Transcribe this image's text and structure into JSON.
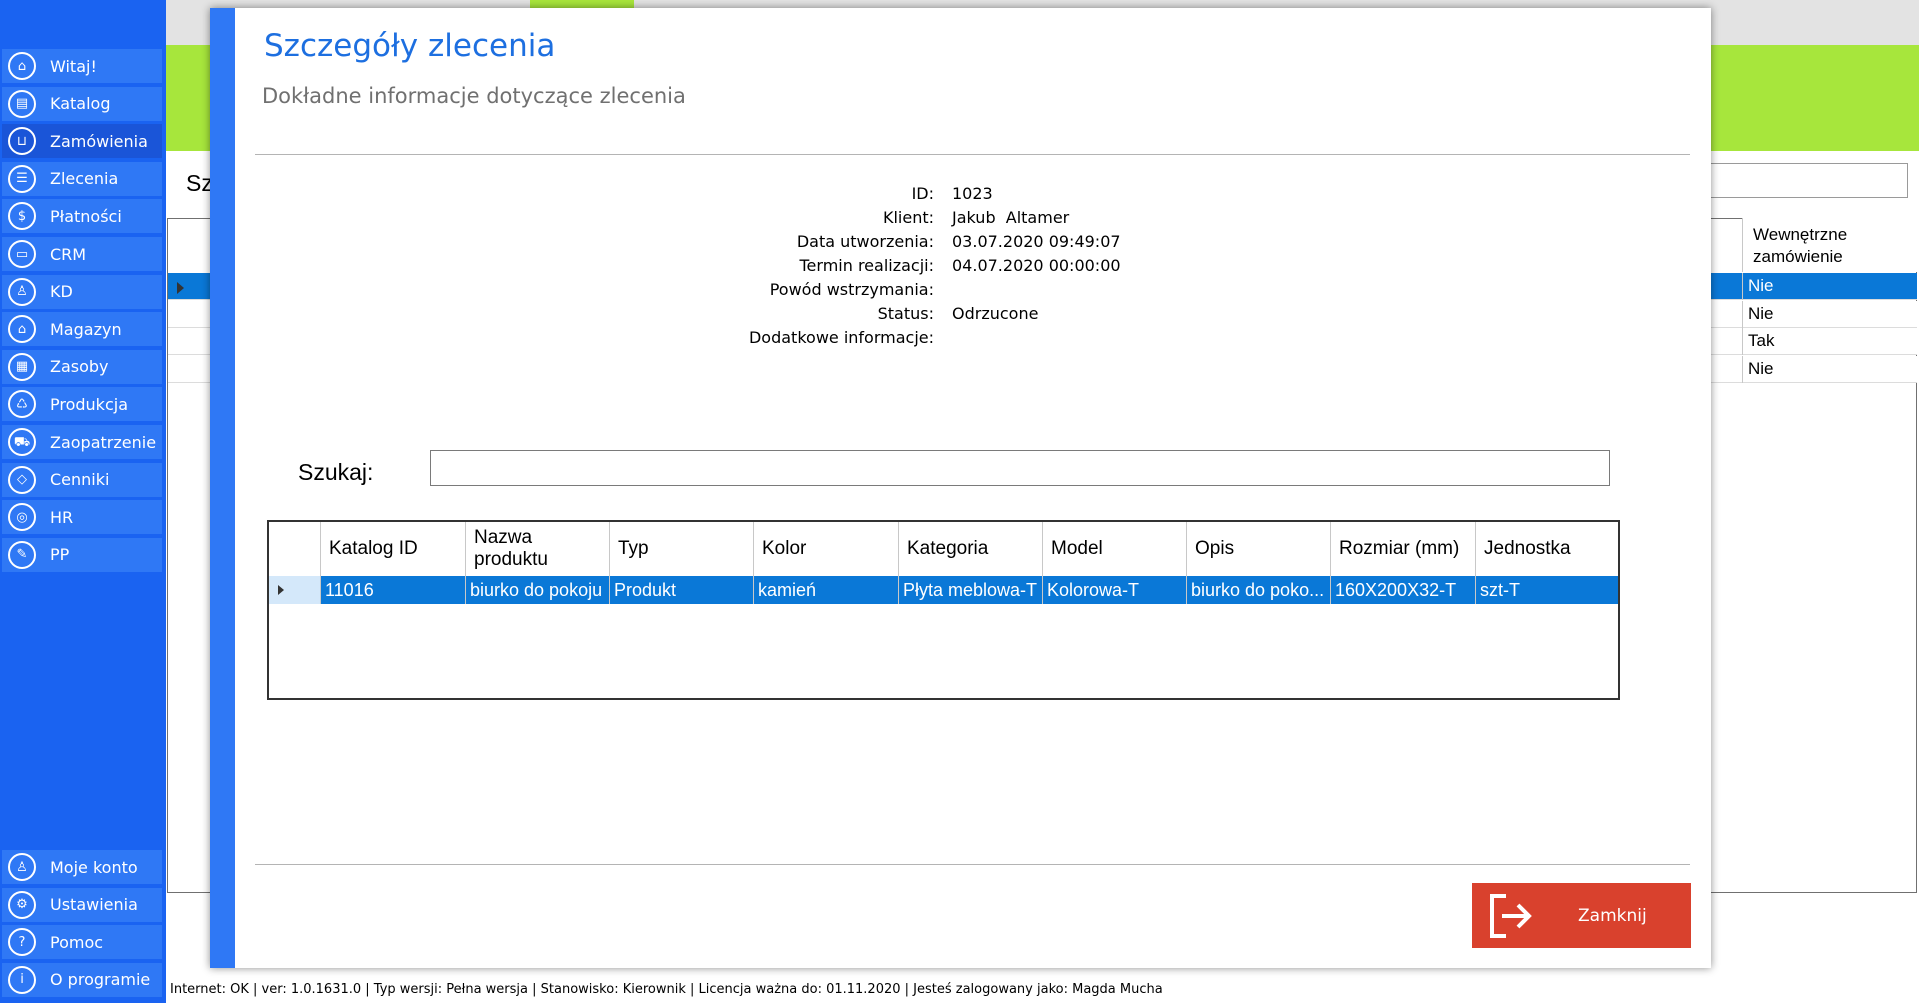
{
  "sidebar": {
    "items": [
      {
        "label": "Witaj!",
        "icon": "home-icon",
        "glyph": "⌂"
      },
      {
        "label": "Katalog",
        "icon": "book-icon",
        "glyph": "▤"
      },
      {
        "label": "Zamówienia",
        "icon": "cart-icon",
        "glyph": "⊔",
        "active": true
      },
      {
        "label": "Zlecenia",
        "icon": "list-icon",
        "glyph": "☰"
      },
      {
        "label": "Płatności",
        "icon": "dollar-icon",
        "glyph": "$"
      },
      {
        "label": "CRM",
        "icon": "crm-icon",
        "glyph": "▭"
      },
      {
        "label": "KD",
        "icon": "user-icon",
        "glyph": "♙"
      },
      {
        "label": "Magazyn",
        "icon": "warehouse-icon",
        "glyph": "⌂"
      },
      {
        "label": "Zasoby",
        "icon": "resources-icon",
        "glyph": "▦"
      },
      {
        "label": "Produkcja",
        "icon": "production-icon",
        "glyph": "♺"
      },
      {
        "label": "Zaopatrzenie",
        "icon": "supply-icon",
        "glyph": "⛟"
      },
      {
        "label": "Cenniki",
        "icon": "tag-icon",
        "glyph": "◇"
      },
      {
        "label": "HR",
        "icon": "hr-icon",
        "glyph": "◎"
      },
      {
        "label": "PP",
        "icon": "pp-icon",
        "glyph": "✎"
      }
    ],
    "bottom_items": [
      {
        "label": "Moje konto",
        "icon": "account-icon",
        "glyph": "♙"
      },
      {
        "label": "Ustawienia",
        "icon": "settings-icon",
        "glyph": "⚙"
      },
      {
        "label": "Pomoc",
        "icon": "help-icon",
        "glyph": "?"
      },
      {
        "label": "O programie",
        "icon": "info-icon",
        "glyph": "i"
      }
    ]
  },
  "background": {
    "title_fragment": "Sz",
    "grid_header": "Wewnętrzne zamówienie",
    "rows": [
      "Nie",
      "Nie",
      "Tak",
      "Nie"
    ]
  },
  "modal": {
    "title": "Szczegóły zlecenia",
    "subtitle": "Dokładne informacje dotyczące zlecenia",
    "details": [
      {
        "label": "ID:",
        "value": "1023"
      },
      {
        "label": "Klient:",
        "value": "Jakub  Altamer"
      },
      {
        "label": "Data utworzenia:",
        "value": "03.07.2020 09:49:07"
      },
      {
        "label": "Termin realizacji:",
        "value": "04.07.2020 00:00:00"
      },
      {
        "label": "Powód wstrzymania:",
        "value": ""
      },
      {
        "label": "Status:",
        "value": "Odrzucone"
      },
      {
        "label": "Dodatkowe informacje:",
        "value": ""
      }
    ],
    "search": {
      "label": "Szukaj:",
      "value": ""
    },
    "grid": {
      "columns": [
        "Katalog ID",
        "Nazwa produktu",
        "Typ",
        "Kolor",
        "Kategoria",
        "Model",
        "Opis",
        "Rozmiar (mm)",
        "Jednostka"
      ],
      "rows": [
        [
          "11016",
          "biurko do pokoju",
          "Produkt",
          "kamień",
          "Płyta meblowa-T",
          "Kolorowa-T",
          "biurko do poko...",
          "160X200X32-T",
          "szt-T"
        ]
      ]
    },
    "close_button": "Zamknij"
  },
  "statusbar": {
    "text": "Internet: OK  |   ver: 1.0.1631.0   |   Typ wersji: Pełna wersja   |   Stanowisko: Kierownik   |   Licencja ważna do: 01.11.2020   |   Jesteś zalogowany jako: Magda Mucha"
  },
  "colors": {
    "sidebar": "#1a63f1",
    "sidebar_item": "#2f78f5",
    "header_green": "#a7e63c",
    "selection": "#0a78d7",
    "close_button": "#d9412d",
    "title_blue": "#1d6fe0"
  }
}
